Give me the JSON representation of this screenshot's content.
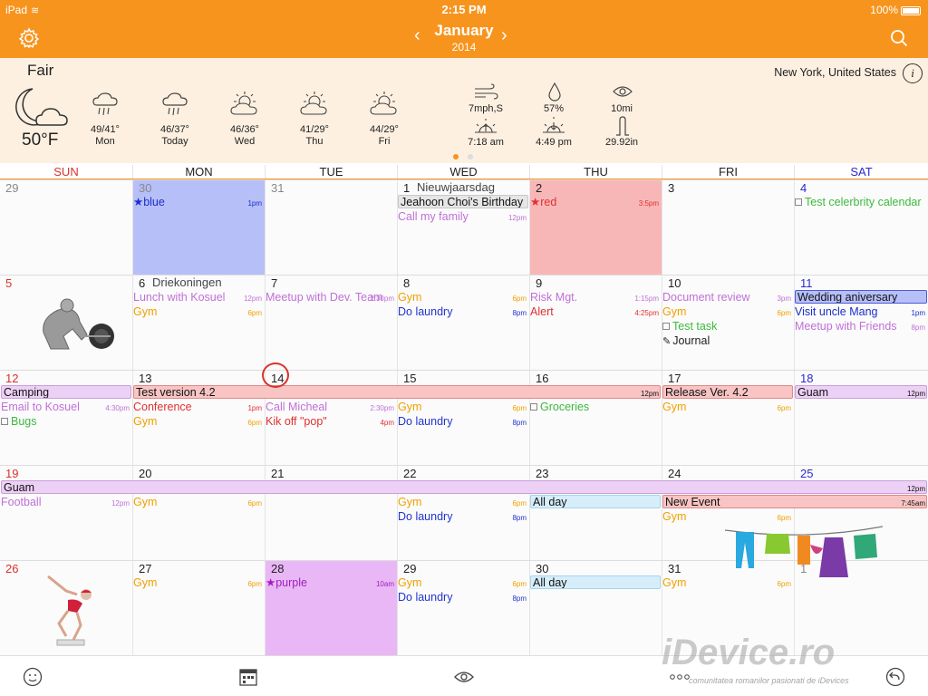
{
  "status": {
    "device": "iPad",
    "time": "2:15 PM",
    "battery": "100%"
  },
  "nav": {
    "month": "January",
    "year": "2014"
  },
  "weather": {
    "condition": "Fair",
    "temp": "50°F",
    "location": "New York, United States",
    "forecast": [
      {
        "hilo": "49/41°",
        "day": "Mon",
        "icon": "rain-icon"
      },
      {
        "hilo": "46/37°",
        "day": "Today",
        "icon": "rain-icon"
      },
      {
        "hilo": "46/36°",
        "day": "Wed",
        "icon": "partly-sunny-icon"
      },
      {
        "hilo": "41/29°",
        "day": "Thu",
        "icon": "partly-sunny-icon"
      },
      {
        "hilo": "44/29°",
        "day": "Fri",
        "icon": "partly-sunny-icon"
      }
    ],
    "wind": "7mph,S",
    "humidity": "57%",
    "visibility": "10mi",
    "sunrise": "7:18 am",
    "sunset": "4:49 pm",
    "pressure": "29.92in"
  },
  "days": [
    "SUN",
    "MON",
    "TUE",
    "WED",
    "THU",
    "FRI",
    "SAT"
  ],
  "colors": {
    "accent": "#f7941d",
    "sunday": "#d9322c",
    "saturday": "#2a2ad0",
    "gym": "#f0a000",
    "laundry": "#2233cc",
    "purple": "#c070d8",
    "red": "#e03030",
    "green": "#3cba3c"
  },
  "weeks": [
    [
      "29",
      "30",
      "31",
      "1",
      "2",
      "3",
      "4"
    ],
    [
      "5",
      "6",
      "7",
      "8",
      "9",
      "10",
      "11"
    ],
    [
      "12",
      "13",
      "14",
      "15",
      "16",
      "17",
      "18"
    ],
    [
      "19",
      "20",
      "21",
      "22",
      "23",
      "24",
      "25"
    ],
    [
      "26",
      "27",
      "28",
      "29",
      "30",
      "31",
      "1"
    ]
  ],
  "holidays": {
    "w0d3": "Nieuwjaarsdag",
    "w1d1": "Driekoningen"
  },
  "events": {
    "w0": {
      "blue": "★blue",
      "blue_t": "1pm",
      "birthday": "Jeahoon Choi's Birthday",
      "family": "Call my family",
      "family_t": "12pm",
      "red": "★red",
      "red_t": "3:5pm",
      "celeb": "Test celerbrity calendar"
    },
    "w1": {
      "lunch": "Lunch with Kosuel",
      "lunch_t": "12pm",
      "gym": "Gym",
      "gym_t": "6pm",
      "meetup": "Meetup with Dev. Team",
      "meetup_t": "2:30pm",
      "laundry": "Do laundry",
      "laundry_t": "8pm",
      "risk": "Risk Mgt.",
      "risk_t": "1:15pm",
      "alert": "Alert",
      "alert_t": "4:25pm",
      "doc": "Document review",
      "doc_t": "3pm",
      "task": "Test task",
      "journal": "Journal",
      "wedding": "Wedding aniversary",
      "uncle": "Visit uncle Mang",
      "uncle_t": "1pm",
      "friends": "Meetup with Friends",
      "friends_t": "8pm"
    },
    "w2": {
      "camping": "Camping",
      "testver": "Test version 4.2",
      "testver_t": "12pm",
      "release": "Release Ver. 4.2",
      "guam": "Guam",
      "guam_t": "12pm",
      "email": "Email to Kosuel",
      "email_t": "4:30pm",
      "conf": "Conference",
      "conf_t": "1pm",
      "micheal": "Call Micheal",
      "micheal_t": "2:30pm",
      "gym": "Gym",
      "gym_t": "6pm",
      "bugs": "Bugs",
      "kik": "Kik off \"pop\"",
      "kik_t": "4pm",
      "laundry": "Do laundry",
      "laundry_t": "8pm",
      "groceries": "Groceries"
    },
    "w3": {
      "guam": "Guam",
      "guam_t": "12pm",
      "football": "Football",
      "football_t": "12pm",
      "gym": "Gym",
      "gym_t": "6pm",
      "laundry": "Do laundry",
      "laundry_t": "8pm",
      "allday": "All day",
      "newev": "New Event",
      "newev_t": "7:45am"
    },
    "w4": {
      "gym": "Gym",
      "gym_t": "6pm",
      "purple": "★purple",
      "purple_t": "10am",
      "laundry": "Do laundry",
      "laundry_t": "8pm",
      "allday": "All day"
    }
  },
  "watermark": {
    "brand": "iDevice.ro",
    "tagline": "comunitatea romanilor pasionati de iDevices"
  }
}
